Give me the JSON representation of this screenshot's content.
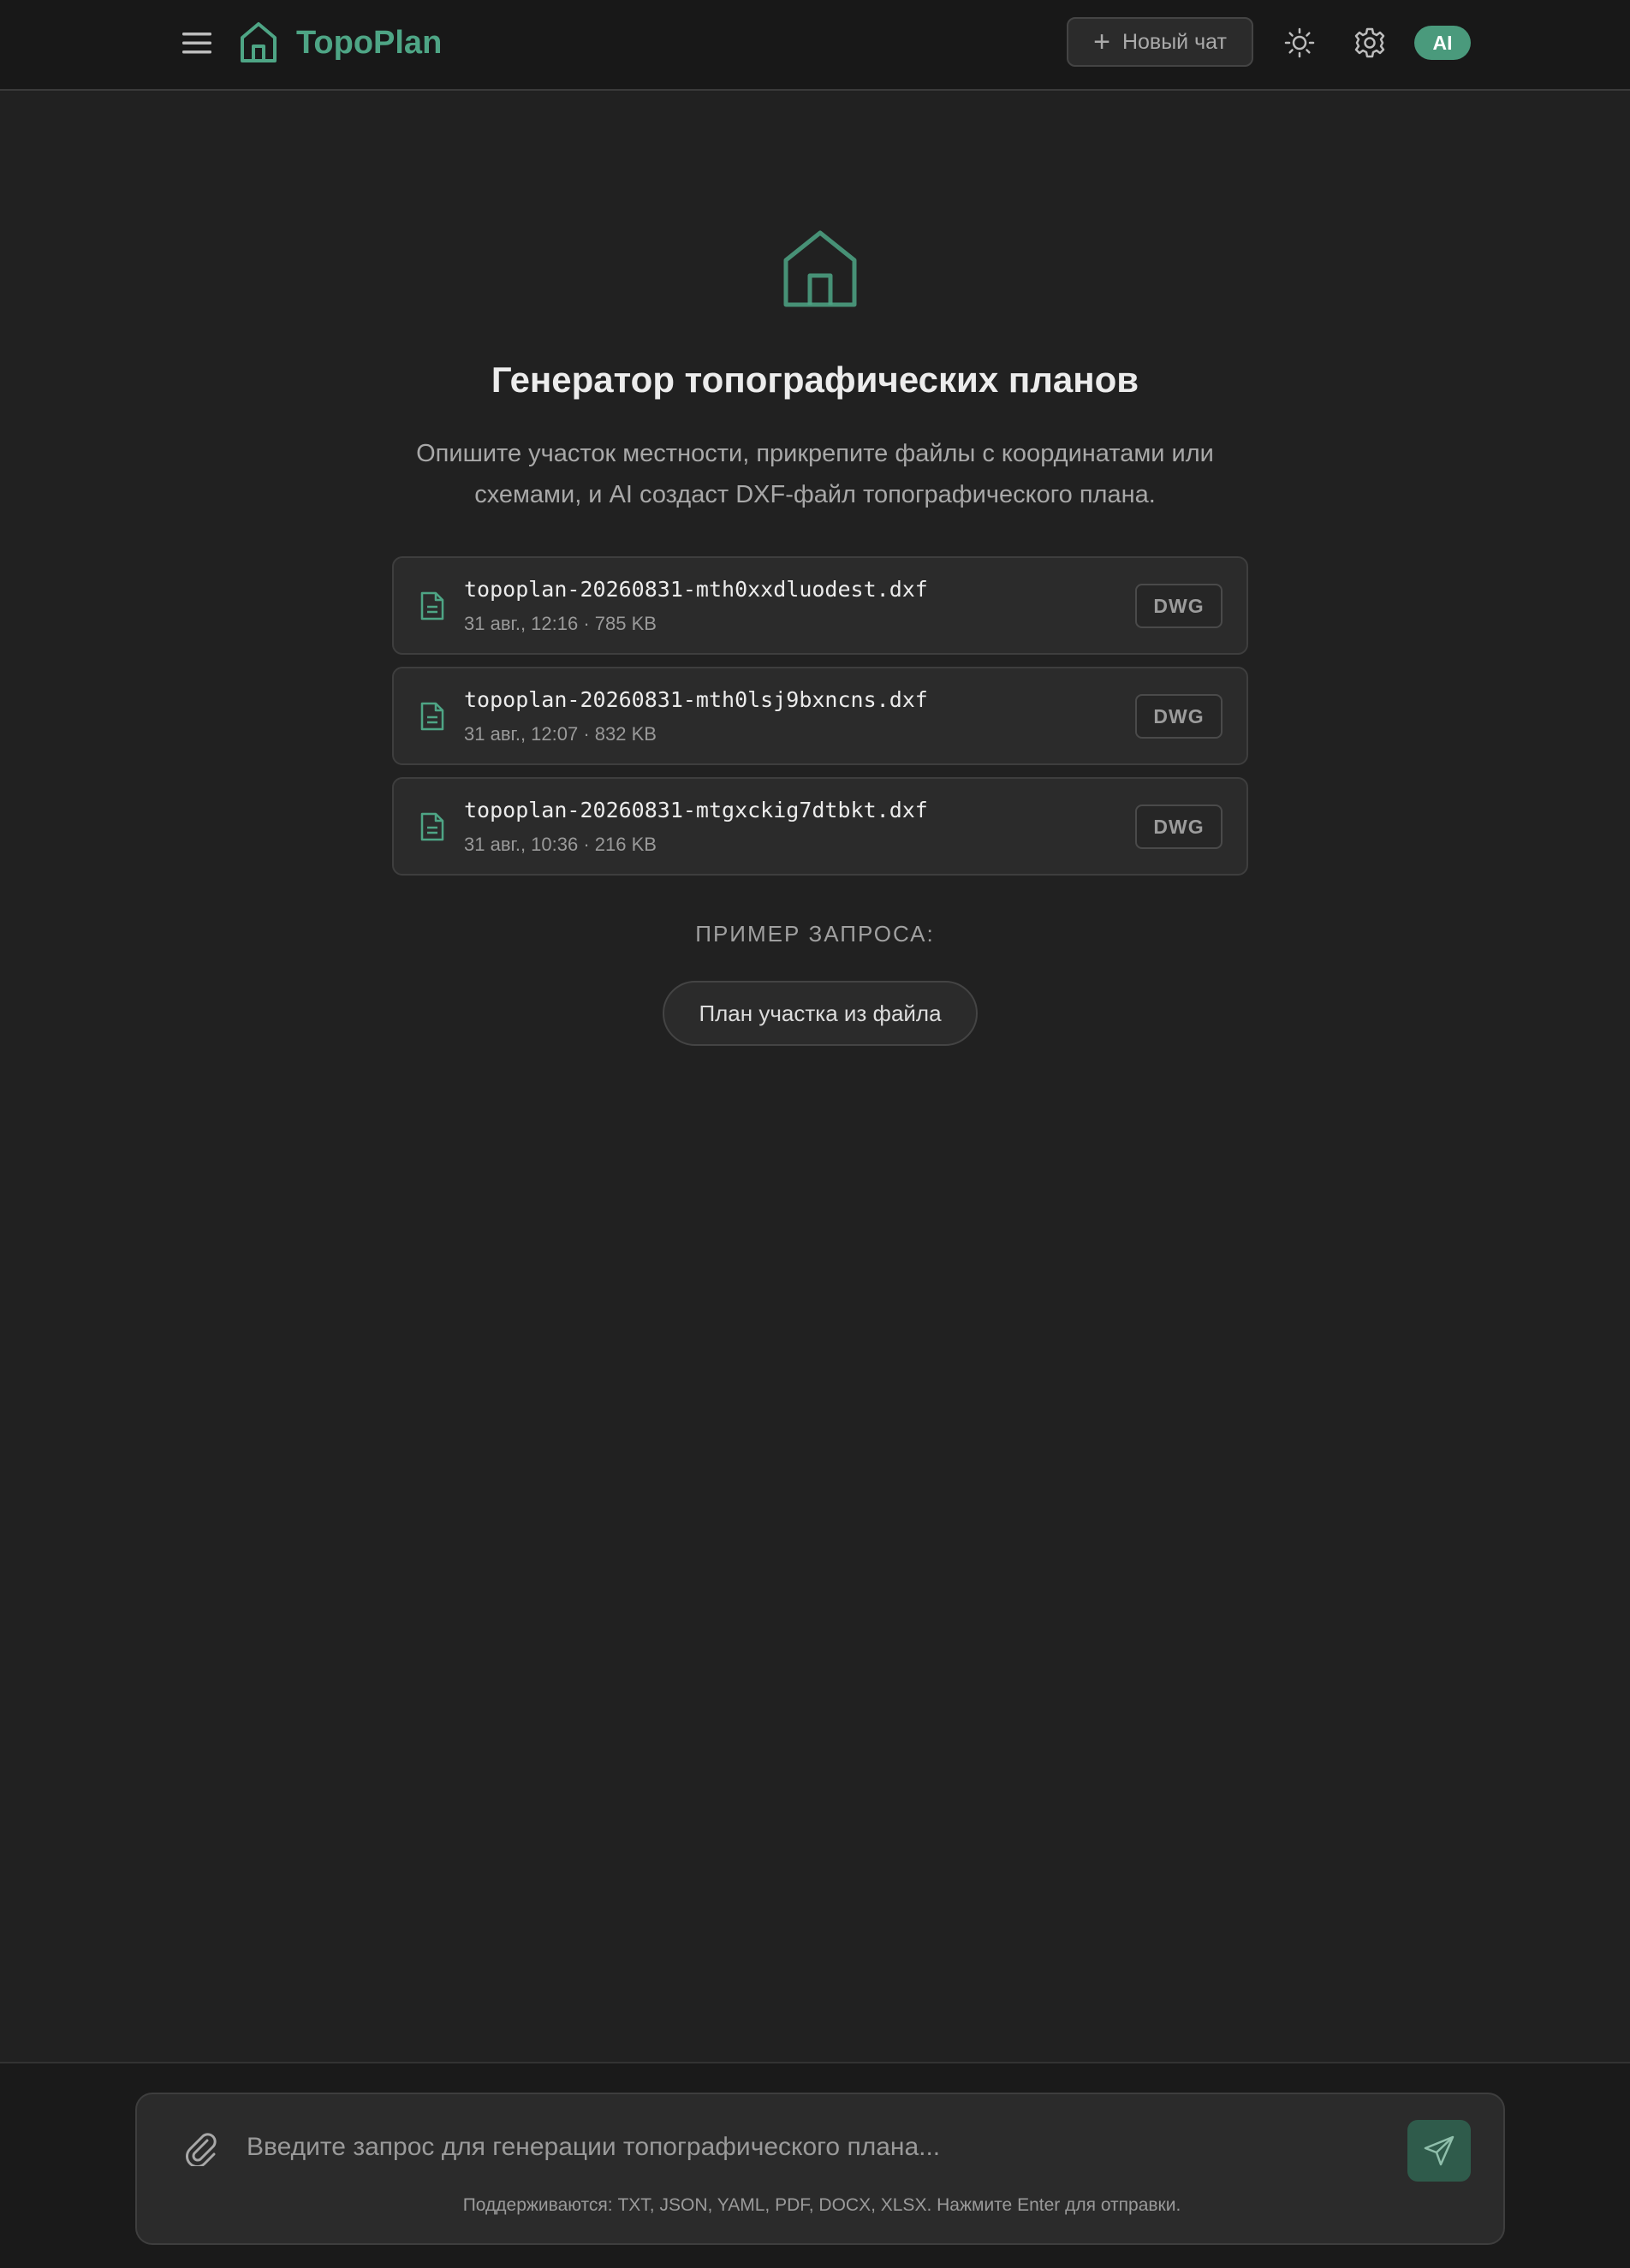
{
  "header": {
    "brand": "TopoPlan",
    "new_chat_label": "Новый чат",
    "avatar_label": "AI"
  },
  "hero": {
    "title": "Генератор топографических планов",
    "description": "Опишите участок местности, прикрепите файлы с координатами или схемами, и AI создаст DXF-файл топографического плана."
  },
  "files": [
    {
      "name": "topoplan-20260831-mth0xxdluodest.dxf",
      "meta": "31 авг., 12:16 · 785 KB",
      "action": "DWG"
    },
    {
      "name": "topoplan-20260831-mth0lsj9bxncns.dxf",
      "meta": "31 авг., 12:07 · 832 KB",
      "action": "DWG"
    },
    {
      "name": "topoplan-20260831-mtgxckig7dtbkt.dxf",
      "meta": "31 авг., 10:36 · 216 KB",
      "action": "DWG"
    }
  ],
  "examples": {
    "label": "ПРИМЕР ЗАПРОСА:",
    "items": [
      "План участка из файла"
    ]
  },
  "composer": {
    "placeholder": "Введите запрос для генерации топографического плана...",
    "value": "",
    "hint": "Поддерживаются: TXT, JSON, YAML, PDF, DOCX, XLSX. Нажмите Enter для отправки."
  },
  "colors": {
    "accent": "#4ea585",
    "background": "#212121",
    "header_bg": "#181818",
    "card_bg": "#2b2b2b",
    "send_button_bg": "#2f5b4b"
  },
  "icons": [
    "menu-icon",
    "home-logo-icon",
    "plus-icon",
    "sun-icon",
    "gear-icon",
    "file-text-icon",
    "paperclip-icon",
    "send-icon"
  ]
}
